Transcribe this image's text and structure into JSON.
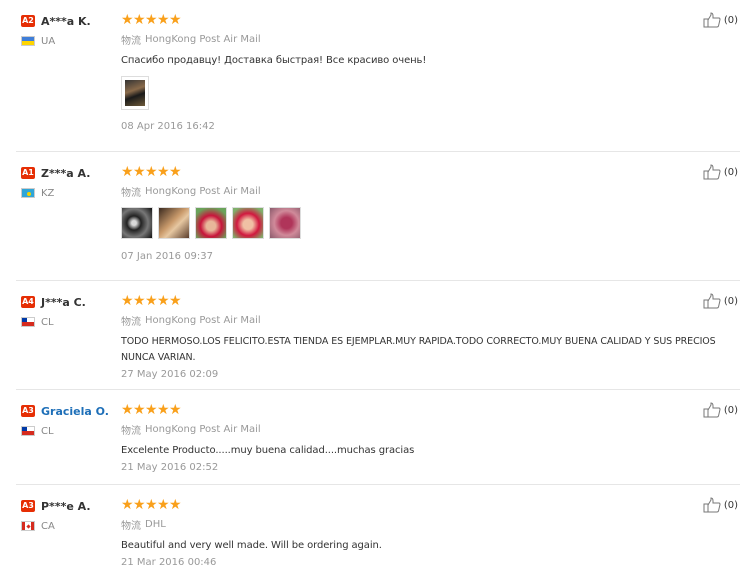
{
  "reviews": [
    {
      "level": "A2",
      "name": "A***a K.",
      "name_is_link": false,
      "country": "UA",
      "flag": "ua",
      "stars": 5,
      "ship_label": "物流",
      "ship_method": "HongKong Post Air Mail",
      "comment": "Спасибо продавцу! Доставка быстрая! Все красиво очень!",
      "photos": [
        "p0"
      ],
      "date": "08 Apr 2016 16:42",
      "helpful_count": "(0)"
    },
    {
      "level": "A1",
      "name": "Z***a A.",
      "name_is_link": false,
      "country": "KZ",
      "flag": "kz",
      "stars": 5,
      "ship_label": "物流",
      "ship_method": "HongKong Post Air Mail",
      "comment": "",
      "photos": [
        "k1",
        "k2",
        "k3",
        "k4",
        "k5"
      ],
      "date": "07 Jan 2016 09:37",
      "helpful_count": "(0)"
    },
    {
      "level": "A4",
      "name": "J***a C.",
      "name_is_link": false,
      "country": "CL",
      "flag": "cl",
      "stars": 5,
      "ship_label": "物流",
      "ship_method": "HongKong Post Air Mail",
      "comment": "TODO HERMOSO.LOS FELICITO.ESTA TIENDA ES EJEMPLAR.MUY RAPIDA.TODO CORRECTO.MUY BUENA CALIDAD Y SUS PRECIOS NUNCA VARIAN.",
      "photos": [],
      "date": "27 May 2016 02:09",
      "helpful_count": "(0)"
    },
    {
      "level": "A3",
      "name": "Graciela O.",
      "name_is_link": true,
      "country": "CL",
      "flag": "cl",
      "stars": 5,
      "ship_label": "物流",
      "ship_method": "HongKong Post Air Mail",
      "comment": "Excelente Producto.....muy buena calidad....muchas gracias",
      "photos": [],
      "date": "21 May 2016 02:52",
      "helpful_count": "(0)"
    },
    {
      "level": "A3",
      "name": "P***e A.",
      "name_is_link": false,
      "country": "CA",
      "flag": "ca",
      "stars": 5,
      "ship_label": "物流",
      "ship_method": "DHL",
      "comment": "Beautiful and very well made. Will be ordering again.",
      "photos": [],
      "date": "21 Mar 2016 00:46",
      "helpful_count": "(0)"
    }
  ],
  "colors": {
    "star": "#f9a01b",
    "level_badge": "#e62e04",
    "link": "#1e6fb8"
  }
}
